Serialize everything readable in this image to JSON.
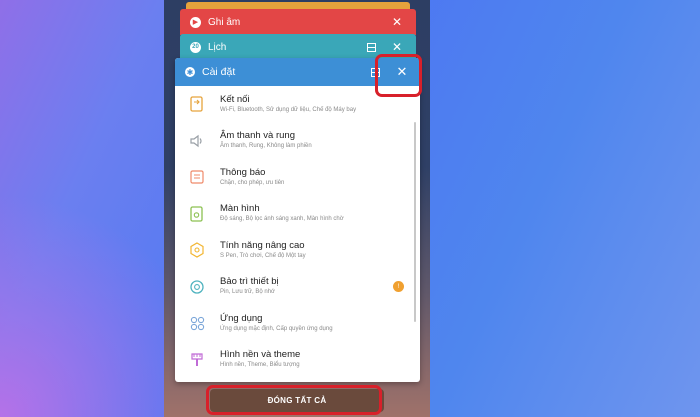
{
  "recent_apps": {
    "cards": [
      {
        "title": "Ghi âm",
        "icon": "record-icon"
      },
      {
        "title": "Lịch",
        "icon": "calendar-icon",
        "icon_text": "20"
      }
    ],
    "active_card": {
      "title": "Cài đặt",
      "icon": "gear-icon",
      "items": [
        {
          "title": "Kết nối",
          "subtitle": "Wi-Fi, Bluetooth, Sử dụng dữ liệu, Chế độ Máy bay",
          "icon": "connections-icon",
          "color": "#e6a33c"
        },
        {
          "title": "Âm thanh và rung",
          "subtitle": "Âm thanh, Rung, Không làm phiền",
          "icon": "sound-icon",
          "color": "#9aa0a6"
        },
        {
          "title": "Thông báo",
          "subtitle": "Chặn, cho phép, ưu tiên",
          "icon": "notification-icon",
          "color": "#ef8a6a"
        },
        {
          "title": "Màn hình",
          "subtitle": "Độ sáng, Bộ lọc ánh sáng xanh, Màn hình chờ",
          "icon": "display-icon",
          "color": "#8cc152"
        },
        {
          "title": "Tính năng nâng cao",
          "subtitle": "S Pen, Trò chơi, Chế độ Một tay",
          "icon": "advanced-features-icon",
          "color": "#f2b632"
        },
        {
          "title": "Bảo trì thiết bị",
          "subtitle": "Pin, Lưu trữ, Bộ nhớ",
          "icon": "device-maintenance-icon",
          "color": "#4fb3bf",
          "badge": "!"
        },
        {
          "title": "Ứng dụng",
          "subtitle": "Ứng dụng mặc định, Cấp quyền ứng dụng",
          "icon": "apps-icon",
          "color": "#7da7d9"
        },
        {
          "title": "Hình nền và theme",
          "subtitle": "Hình nền, Theme, Biểu tượng",
          "icon": "wallpaper-theme-icon",
          "color": "#c06bd6"
        }
      ]
    },
    "close_all_label": "ĐÓNG TẤT CẢ"
  },
  "colors": {
    "ghi_am": "#e34646",
    "lich": "#3aa7b8",
    "cai_dat_header": "#3d8fd6",
    "highlight": "#d8202a"
  }
}
